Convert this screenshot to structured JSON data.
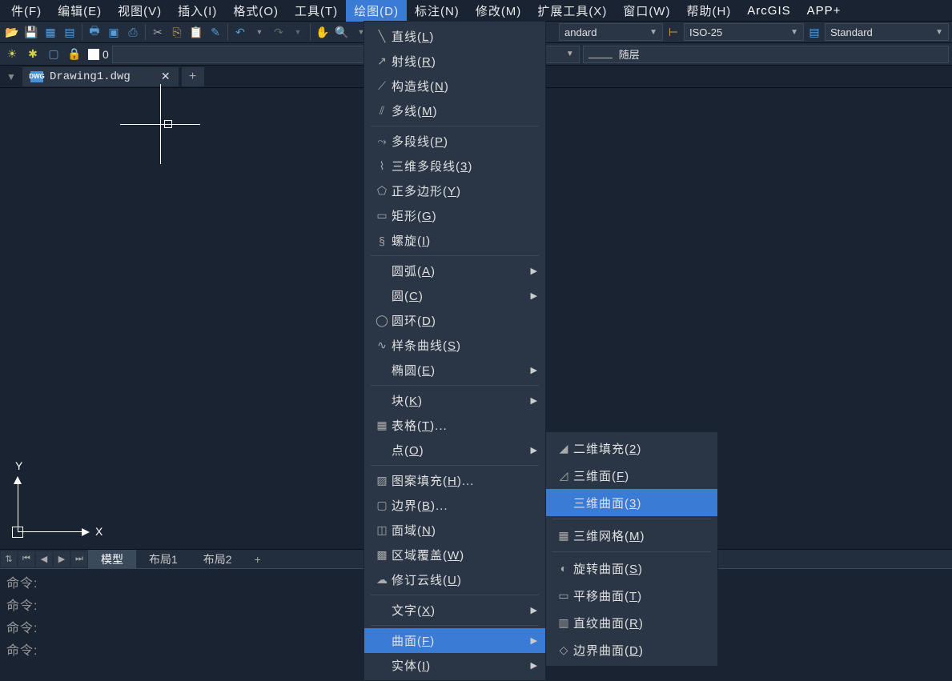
{
  "menubar": {
    "items": [
      {
        "label": "件(F)",
        "active": false
      },
      {
        "label": "编辑(E)",
        "active": false
      },
      {
        "label": "视图(V)",
        "active": false
      },
      {
        "label": "插入(I)",
        "active": false
      },
      {
        "label": "格式(O)",
        "active": false
      },
      {
        "label": "工具(T)",
        "active": false
      },
      {
        "label": "绘图(D)",
        "active": true
      },
      {
        "label": "标注(N)",
        "active": false
      },
      {
        "label": "修改(M)",
        "active": false
      },
      {
        "label": "扩展工具(X)",
        "active": false
      },
      {
        "label": "窗口(W)",
        "active": false
      },
      {
        "label": "帮助(H)",
        "active": false
      },
      {
        "label": "ArcGIS",
        "active": false,
        "highlight": true
      },
      {
        "label": "APP+",
        "active": false,
        "highlight": true
      }
    ]
  },
  "toolbar": {
    "dropdowns": {
      "a": "andard",
      "b": "ISO-25",
      "c": "Standard"
    }
  },
  "layerbar": {
    "current": "0",
    "bylayer1": "随层",
    "bylayer2": "随层"
  },
  "tabs": {
    "file": "Drawing1.dwg"
  },
  "layouts": {
    "model": "模型",
    "l1": "布局1",
    "l2": "布局2"
  },
  "cmd": {
    "prompt": "命令:"
  },
  "drawmenu": {
    "groups": [
      [
        {
          "icon": "line",
          "label": "直线(<u>L</u>)",
          "sub": false
        },
        {
          "icon": "ray",
          "label": "射线(<u>R</u>)",
          "sub": false
        },
        {
          "icon": "xline",
          "label": "构造线(<u>N</u>)",
          "sub": false
        },
        {
          "icon": "mline",
          "label": "多线(<u>M</u>)",
          "sub": false
        }
      ],
      [
        {
          "icon": "pline",
          "label": "多段线(<u>P</u>)",
          "sub": false
        },
        {
          "icon": "3dpoly",
          "label": "三维多段线(<u>3</u>)",
          "sub": false
        },
        {
          "icon": "polygon",
          "label": "正多边形(<u>Y</u>)",
          "sub": false
        },
        {
          "icon": "rect",
          "label": "矩形(<u>G</u>)",
          "sub": false
        },
        {
          "icon": "helix",
          "label": "螺旋(<u>I</u>)",
          "sub": false
        }
      ],
      [
        {
          "icon": "",
          "label": "圆弧(<u>A</u>)",
          "sub": true
        },
        {
          "icon": "",
          "label": "圆(<u>C</u>)",
          "sub": true
        },
        {
          "icon": "donut",
          "label": "圆环(<u>D</u>)",
          "sub": false
        },
        {
          "icon": "spline",
          "label": "样条曲线(<u>S</u>)",
          "sub": false
        },
        {
          "icon": "",
          "label": "椭圆(<u>E</u>)",
          "sub": true
        }
      ],
      [
        {
          "icon": "",
          "label": "块(<u>K</u>)",
          "sub": true
        },
        {
          "icon": "table",
          "label": "表格(<u>T</u>)...",
          "sub": false
        },
        {
          "icon": "",
          "label": "点(<u>O</u>)",
          "sub": true
        }
      ],
      [
        {
          "icon": "hatch",
          "label": "图案填充(<u>H</u>)...",
          "sub": false
        },
        {
          "icon": "boundary",
          "label": "边界(<u>B</u>)...",
          "sub": false
        },
        {
          "icon": "region",
          "label": "面域(<u>N</u>)",
          "sub": false
        },
        {
          "icon": "wipeout",
          "label": "区域覆盖(<u>W</u>)",
          "sub": false
        },
        {
          "icon": "revcloud",
          "label": "修订云线(<u>U</u>)",
          "sub": false
        }
      ],
      [
        {
          "icon": "",
          "label": "文字(<u>X</u>)",
          "sub": true
        }
      ],
      [
        {
          "icon": "",
          "label": "曲面(<u>F</u>)",
          "sub": true,
          "highlighted": true
        },
        {
          "icon": "",
          "label": "实体(<u>I</u>)",
          "sub": true
        }
      ]
    ]
  },
  "surfacemenu": {
    "groups": [
      [
        {
          "icon": "solid2d",
          "label": "二维填充(<u>2</u>)"
        },
        {
          "icon": "3dface",
          "label": "三维面(<u>F</u>)"
        },
        {
          "icon": "3dsurf",
          "label": "三维曲面(<u>3</u>)",
          "highlighted": true
        }
      ],
      [
        {
          "icon": "3dmesh",
          "label": "三维网格(<u>M</u>)"
        }
      ],
      [
        {
          "icon": "revsurf",
          "label": "旋转曲面(<u>S</u>)"
        },
        {
          "icon": "tabsurf",
          "label": "平移曲面(<u>T</u>)"
        },
        {
          "icon": "rulesurf",
          "label": "直纹曲面(<u>R</u>)"
        },
        {
          "icon": "edgesurf",
          "label": "边界曲面(<u>D</u>)"
        }
      ]
    ]
  }
}
